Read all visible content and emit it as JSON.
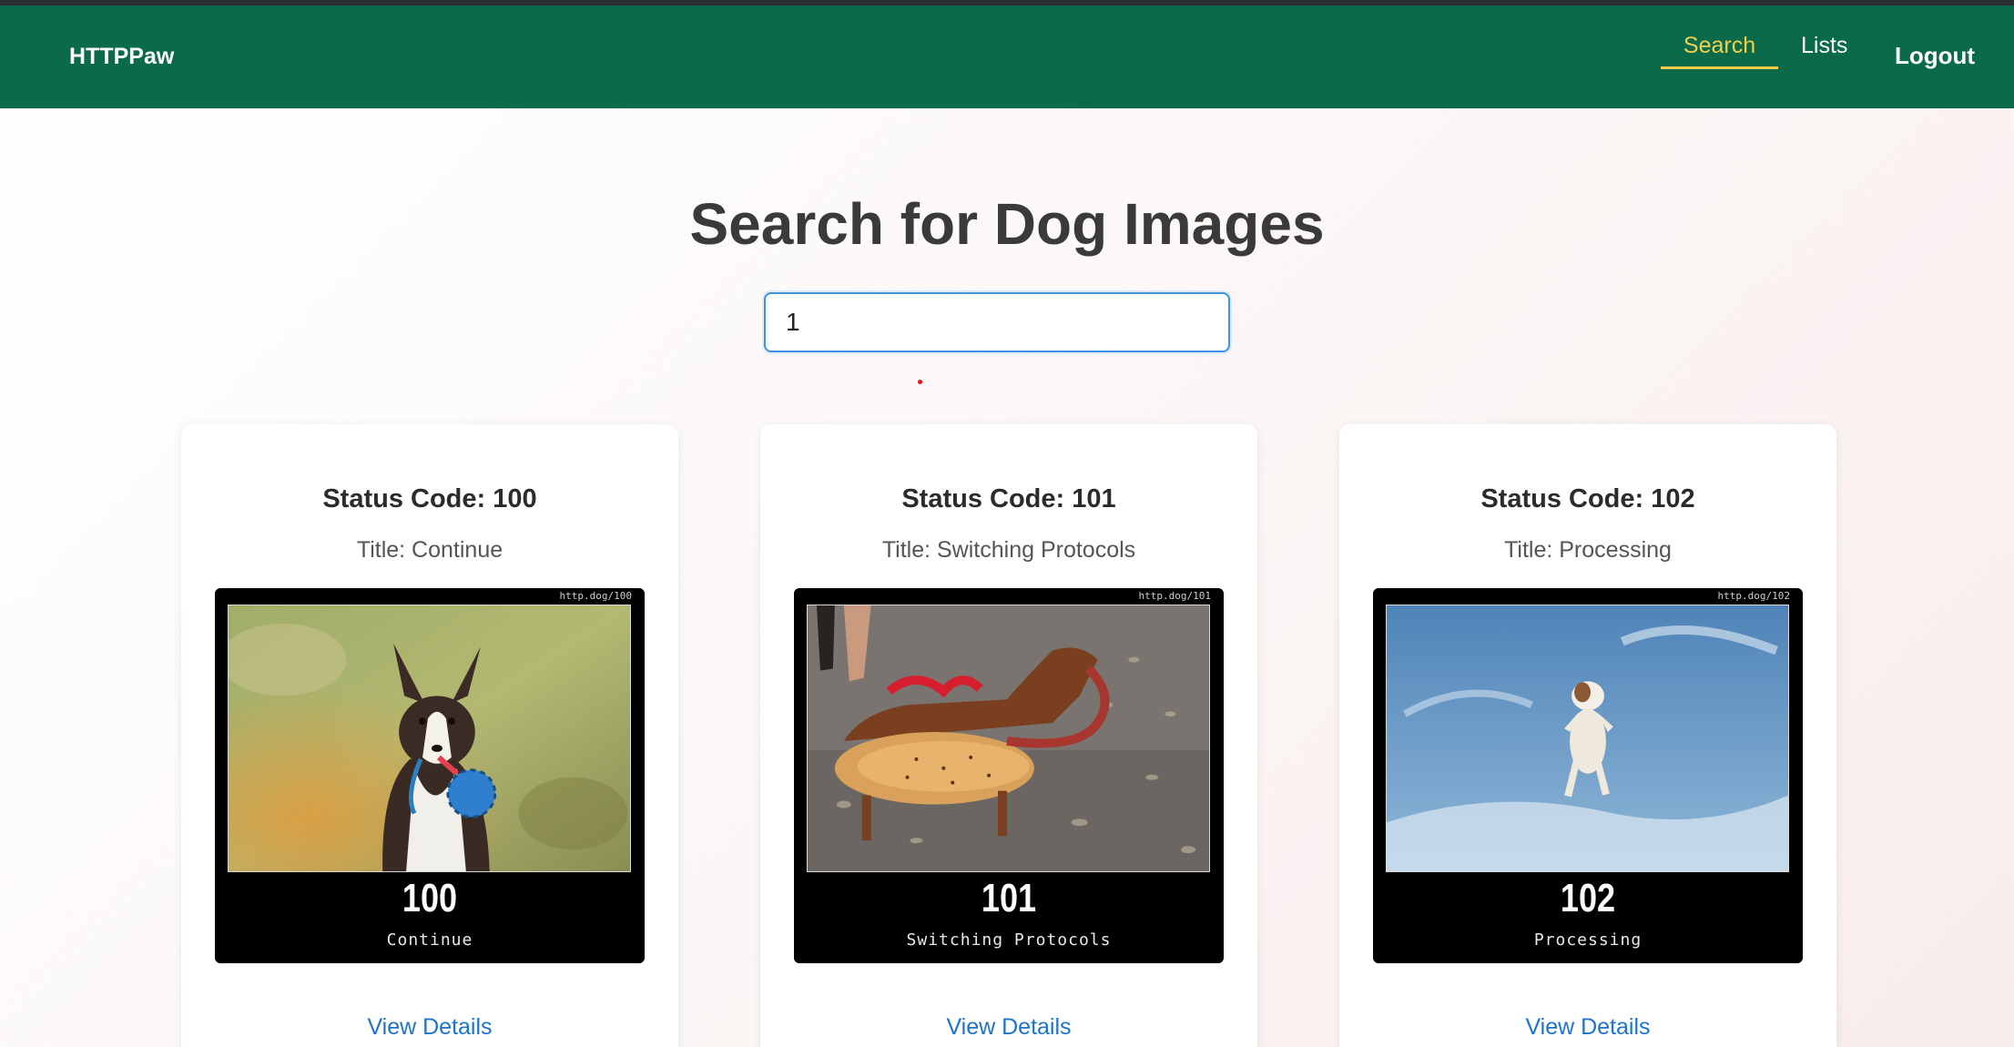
{
  "header": {
    "brand": "HTTPPaw",
    "nav": [
      {
        "label": "Search",
        "active": true
      },
      {
        "label": "Lists",
        "active": false
      }
    ],
    "logout_label": "Logout",
    "colors": {
      "bar": "#0b6a4a",
      "active": "#f2cf4a"
    }
  },
  "main": {
    "title": "Search for Dog Images",
    "search": {
      "value": "1",
      "placeholder": ""
    }
  },
  "results": [
    {
      "code_heading": "Status Code: 100",
      "title_line": "Title: Continue",
      "frame_url": "http.dog/100",
      "frame_code": "100",
      "frame_text": "Continue",
      "link_label": "View Details",
      "image_icon": "dog-with-ball-photo"
    },
    {
      "code_heading": "Status Code: 101",
      "title_line": "Title: Switching Protocols",
      "frame_url": "http.dog/101",
      "frame_code": "101",
      "frame_text": "Switching Protocols",
      "link_label": "View Details",
      "image_icon": "hotdog-costume-dog-photo"
    },
    {
      "code_heading": "Status Code: 102",
      "title_line": "Title: Processing",
      "frame_url": "http.dog/102",
      "frame_code": "102",
      "frame_text": "Processing",
      "link_label": "View Details",
      "image_icon": "jumping-dog-sky-photo"
    }
  ]
}
